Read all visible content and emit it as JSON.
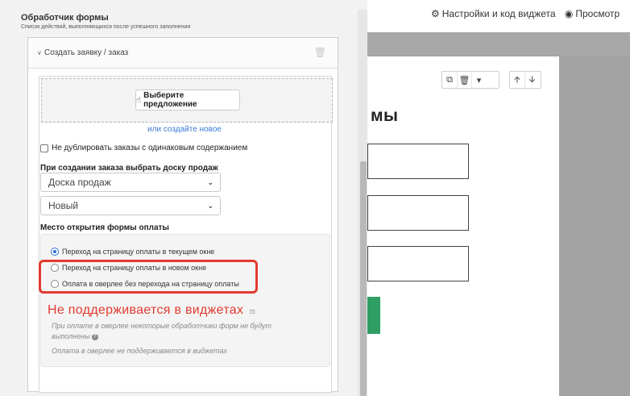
{
  "toolbar": {
    "settings_label": "Настройки и код виджета",
    "preview_label": "Просмотр"
  },
  "panel": {
    "title": "Обработчик формы",
    "subtitle": "Список действий, выполняющихся после успешного заполнения"
  },
  "action": {
    "title": "Создать заявку / заказ",
    "offer_button": "Выберите предложение",
    "create_new_link": "или создайте новое",
    "no_duplicates_label": "Не дублировать заказы с одинаковым содержанием",
    "no_duplicates_checked": false,
    "board_label": "При создании заказа выбрать доску продаж",
    "board_select_value": "Доска продаж",
    "stage_select_value": "Новый",
    "payment_location_label": "Место открытия формы оплаты",
    "payment_options": [
      {
        "label": "Переход на страницу оплаты в текущем окне",
        "selected": true
      },
      {
        "label": "Переход на страницу оплаты в новом окне",
        "selected": false
      },
      {
        "label": "Оплата в оверлее без перехода на страницу оплаты",
        "selected": false
      }
    ],
    "note_partial_tail": "ts",
    "note_overlay": "При оплате в оверлее некоторые обработчики форм не будут выполнены",
    "note_widget": "Оплата в оверлее не поддерживается в виджетах"
  },
  "annotation": {
    "text": "Не поддерживается в виджетах",
    "color": "#e23a2f"
  },
  "preview": {
    "form_title": "мы"
  },
  "colors": {
    "accent": "#2f6fdc",
    "link": "#3a7bd5",
    "submit_button": "#2e9e63"
  }
}
